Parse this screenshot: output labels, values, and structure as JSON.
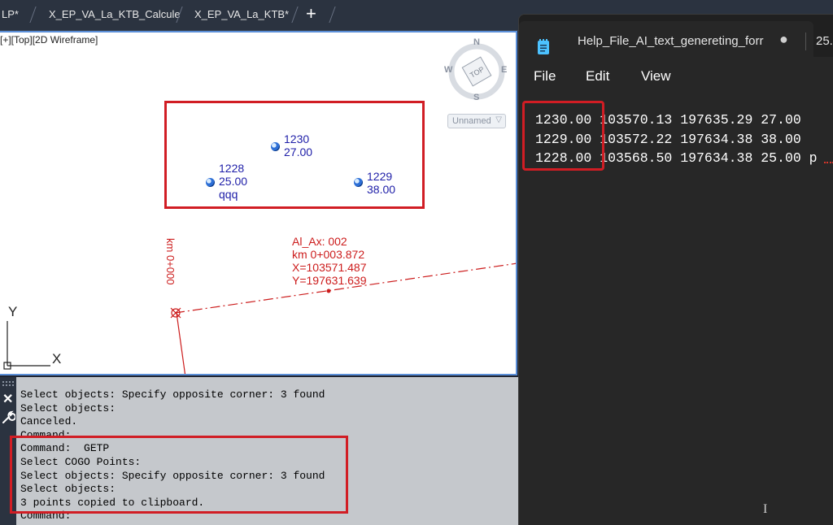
{
  "tabs": [
    {
      "label": "LP*"
    },
    {
      "label": "X_EP_VA_La_KTB_Calcule"
    },
    {
      "label": "X_EP_VA_La_KTB*"
    }
  ],
  "tab_close_glyph": "✕",
  "new_tab_glyph": "+",
  "viewport": {
    "label": "[+][Top][2D Wireframe]",
    "points": [
      {
        "number": "1230",
        "elevation": "27.00",
        "description": ""
      },
      {
        "number": "1228",
        "elevation": "25.00",
        "description": "qqq"
      },
      {
        "number": "1229",
        "elevation": "38.00",
        "description": ""
      }
    ],
    "alignment_label": {
      "line1": "Al_Ax: 002",
      "line2": "km 0+003.872",
      "line3": "X=103571.487",
      "line4": "Y=197631.639"
    },
    "station_label": "km 0+000",
    "ucs": {
      "x": "X",
      "y": "Y"
    },
    "viewcube": {
      "n": "N",
      "s": "S",
      "e": "E",
      "w": "W",
      "face": "TOP"
    },
    "named_view": "Unnamed",
    "colors": {
      "points_text": "#1e1ea8",
      "alignment": "#cc1c1c",
      "highlight_box": "#d11d24",
      "viewport_border": "#5b8fd8"
    }
  },
  "command_line": {
    "close_glyph": "✕",
    "lines": [
      "Select objects: Specify opposite corner: 3 found",
      "Select objects:",
      "Canceled.",
      "Command:",
      "Command:  GETP",
      "Select COGO Points:",
      "Select objects: Specify opposite corner: 3 found",
      "Select objects:",
      "3 points copied to clipboard.",
      "Command:"
    ]
  },
  "notepad": {
    "title": "Help_File_AI_text_genereting_forr",
    "modified_indicator": "●",
    "second_tab": "25.",
    "menu": [
      "File",
      "Edit",
      "View"
    ],
    "content_lines": [
      "1230.00 103570.13 197635.29 27.00",
      "1229.00 103572.22 197634.38 38.00",
      "1228.00 103568.50 197634.38 25.00 p"
    ],
    "text_cursor_glyph": "I"
  }
}
